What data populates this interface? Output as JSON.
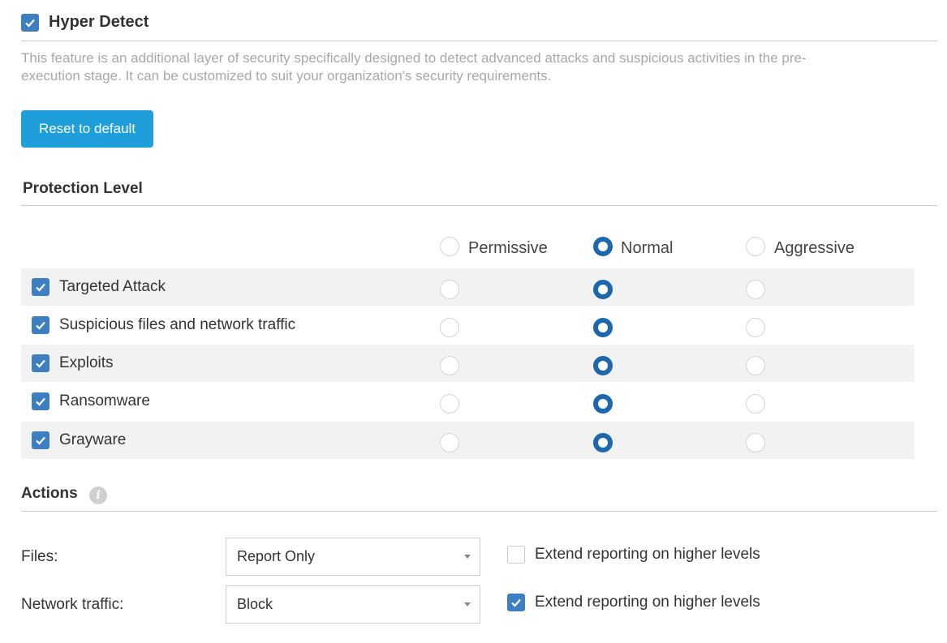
{
  "header": {
    "checkbox_checked": true,
    "title": "Hyper Detect",
    "description": "This feature is an additional layer of security specifically designed to detect advanced attacks and suspicious activities in the pre-execution stage. It can be customized to suit your organization's security requirements.",
    "description_line1": "This feature is an additional layer of security specifically designed to detect advanced attacks and suspicious activities in the pre-",
    "description_line2": "execution stage. It can be customized to suit your organization's security requirements.",
    "reset_label": "Reset to default"
  },
  "protection": {
    "title": "Protection Level",
    "levels": [
      "Permissive",
      "Normal",
      "Aggressive"
    ],
    "selected_header": "Normal",
    "rows": [
      {
        "label": "Targeted Attack",
        "checked": true,
        "selected": "Normal"
      },
      {
        "label": "Suspicious files and network traffic",
        "checked": true,
        "selected": "Normal"
      },
      {
        "label": "Exploits",
        "checked": true,
        "selected": "Normal"
      },
      {
        "label": "Ransomware",
        "checked": true,
        "selected": "Normal"
      },
      {
        "label": "Grayware",
        "checked": true,
        "selected": "Normal"
      }
    ]
  },
  "actions": {
    "title": "Actions",
    "info_icon": "info-icon",
    "files": {
      "label": "Files:",
      "value": "Report Only",
      "extend_label": "Extend reporting on higher levels",
      "extend_checked": false
    },
    "network": {
      "label": "Network traffic:",
      "value": "Block",
      "extend_label": "Extend reporting on higher levels",
      "extend_checked": true
    }
  },
  "colors": {
    "accent": "#1e9fdc",
    "checkbox": "#3d7fc1",
    "radio": "#1d68ad",
    "row_bg": "#f2f2f2"
  }
}
